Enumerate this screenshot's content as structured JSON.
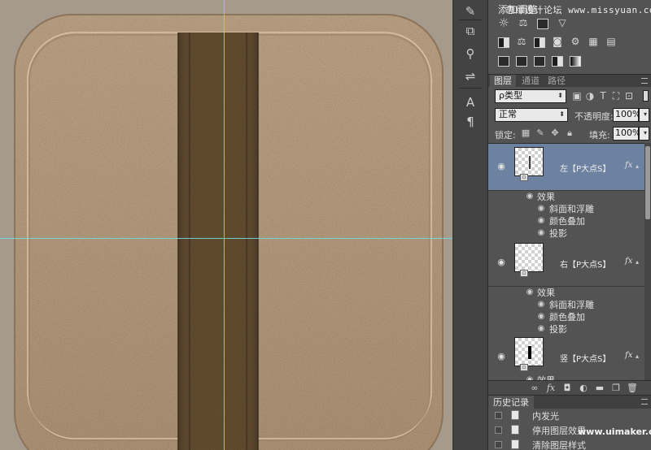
{
  "canvas": {
    "background": "#a69a8c",
    "tile_color": "#c5a98a",
    "strap_color": "#6b5439",
    "strap_dark": "#4e3b27",
    "guide_color": "#6fdce0"
  },
  "adjustments": {
    "title": "添加调整",
    "watermark": "思缘设计论坛 www.missyuan.com",
    "icons_row1": [
      "brightness-icon",
      "levels-icon",
      "curves-icon",
      "exposure-icon"
    ],
    "icons_row2": [
      "vibrance-icon",
      "hue-saturation-icon",
      "color-balance-icon",
      "black-white-icon",
      "photo-filter-icon",
      "channel-mixer-icon",
      "color-lookup-icon"
    ],
    "icons_row3": [
      "invert-icon",
      "posterize-icon",
      "threshold-icon",
      "selective-color-icon",
      "gradient-map-icon"
    ]
  },
  "layers_panel": {
    "tabs": [
      "图层",
      "通道",
      "路径"
    ],
    "filter": {
      "value": "ρ类型"
    },
    "blend_mode": {
      "value": "正常"
    },
    "opacity": {
      "label": "不透明度:",
      "value": "100%"
    },
    "lock_label": "锁定:",
    "fill": {
      "label": "填充:",
      "value": "100%"
    },
    "layers": [
      {
        "name": "左【P大点S】",
        "fx": "fx",
        "selected": true,
        "effects_label": "效果",
        "effects": [
          "斜面和浮雕",
          "颜色叠加",
          "投影"
        ]
      },
      {
        "name": "右【P大点S】",
        "fx": "fx",
        "selected": false,
        "effects_label": "效果",
        "effects": [
          "斜面和浮雕",
          "颜色叠加",
          "投影"
        ]
      },
      {
        "name": "竖【P大点S】",
        "fx": "fx",
        "selected": false,
        "effects_label": "效果",
        "effects": []
      }
    ],
    "footer_icons": [
      "link-icon",
      "fx-icon",
      "mask-icon",
      "adjustment-icon",
      "folder-icon",
      "new-layer-icon",
      "trash-icon"
    ]
  },
  "history": {
    "tab": "历史记录",
    "items": [
      "内发光",
      "停用图层效果",
      "清除图层样式"
    ],
    "watermark": "www.uimaker.com"
  }
}
